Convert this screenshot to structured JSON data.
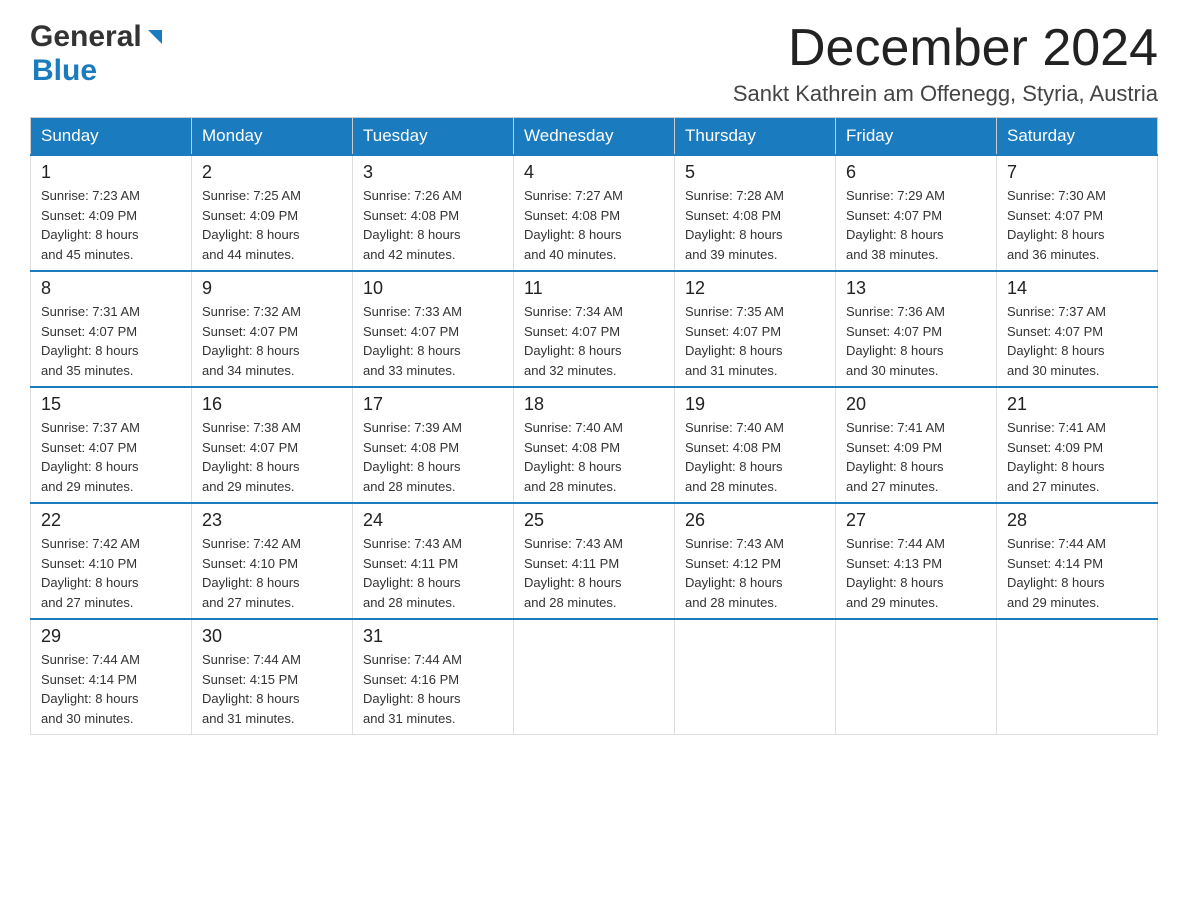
{
  "header": {
    "logo_general": "General",
    "logo_blue": "Blue",
    "month_year": "December 2024",
    "location": "Sankt Kathrein am Offenegg, Styria, Austria"
  },
  "weekdays": [
    "Sunday",
    "Monday",
    "Tuesday",
    "Wednesday",
    "Thursday",
    "Friday",
    "Saturday"
  ],
  "weeks": [
    [
      {
        "day": "1",
        "sunrise": "7:23 AM",
        "sunset": "4:09 PM",
        "daylight": "8 hours and 45 minutes."
      },
      {
        "day": "2",
        "sunrise": "7:25 AM",
        "sunset": "4:09 PM",
        "daylight": "8 hours and 44 minutes."
      },
      {
        "day": "3",
        "sunrise": "7:26 AM",
        "sunset": "4:08 PM",
        "daylight": "8 hours and 42 minutes."
      },
      {
        "day": "4",
        "sunrise": "7:27 AM",
        "sunset": "4:08 PM",
        "daylight": "8 hours and 40 minutes."
      },
      {
        "day": "5",
        "sunrise": "7:28 AM",
        "sunset": "4:08 PM",
        "daylight": "8 hours and 39 minutes."
      },
      {
        "day": "6",
        "sunrise": "7:29 AM",
        "sunset": "4:07 PM",
        "daylight": "8 hours and 38 minutes."
      },
      {
        "day": "7",
        "sunrise": "7:30 AM",
        "sunset": "4:07 PM",
        "daylight": "8 hours and 36 minutes."
      }
    ],
    [
      {
        "day": "8",
        "sunrise": "7:31 AM",
        "sunset": "4:07 PM",
        "daylight": "8 hours and 35 minutes."
      },
      {
        "day": "9",
        "sunrise": "7:32 AM",
        "sunset": "4:07 PM",
        "daylight": "8 hours and 34 minutes."
      },
      {
        "day": "10",
        "sunrise": "7:33 AM",
        "sunset": "4:07 PM",
        "daylight": "8 hours and 33 minutes."
      },
      {
        "day": "11",
        "sunrise": "7:34 AM",
        "sunset": "4:07 PM",
        "daylight": "8 hours and 32 minutes."
      },
      {
        "day": "12",
        "sunrise": "7:35 AM",
        "sunset": "4:07 PM",
        "daylight": "8 hours and 31 minutes."
      },
      {
        "day": "13",
        "sunrise": "7:36 AM",
        "sunset": "4:07 PM",
        "daylight": "8 hours and 30 minutes."
      },
      {
        "day": "14",
        "sunrise": "7:37 AM",
        "sunset": "4:07 PM",
        "daylight": "8 hours and 30 minutes."
      }
    ],
    [
      {
        "day": "15",
        "sunrise": "7:37 AM",
        "sunset": "4:07 PM",
        "daylight": "8 hours and 29 minutes."
      },
      {
        "day": "16",
        "sunrise": "7:38 AM",
        "sunset": "4:07 PM",
        "daylight": "8 hours and 29 minutes."
      },
      {
        "day": "17",
        "sunrise": "7:39 AM",
        "sunset": "4:08 PM",
        "daylight": "8 hours and 28 minutes."
      },
      {
        "day": "18",
        "sunrise": "7:40 AM",
        "sunset": "4:08 PM",
        "daylight": "8 hours and 28 minutes."
      },
      {
        "day": "19",
        "sunrise": "7:40 AM",
        "sunset": "4:08 PM",
        "daylight": "8 hours and 28 minutes."
      },
      {
        "day": "20",
        "sunrise": "7:41 AM",
        "sunset": "4:09 PM",
        "daylight": "8 hours and 27 minutes."
      },
      {
        "day": "21",
        "sunrise": "7:41 AM",
        "sunset": "4:09 PM",
        "daylight": "8 hours and 27 minutes."
      }
    ],
    [
      {
        "day": "22",
        "sunrise": "7:42 AM",
        "sunset": "4:10 PM",
        "daylight": "8 hours and 27 minutes."
      },
      {
        "day": "23",
        "sunrise": "7:42 AM",
        "sunset": "4:10 PM",
        "daylight": "8 hours and 27 minutes."
      },
      {
        "day": "24",
        "sunrise": "7:43 AM",
        "sunset": "4:11 PM",
        "daylight": "8 hours and 28 minutes."
      },
      {
        "day": "25",
        "sunrise": "7:43 AM",
        "sunset": "4:11 PM",
        "daylight": "8 hours and 28 minutes."
      },
      {
        "day": "26",
        "sunrise": "7:43 AM",
        "sunset": "4:12 PM",
        "daylight": "8 hours and 28 minutes."
      },
      {
        "day": "27",
        "sunrise": "7:44 AM",
        "sunset": "4:13 PM",
        "daylight": "8 hours and 29 minutes."
      },
      {
        "day": "28",
        "sunrise": "7:44 AM",
        "sunset": "4:14 PM",
        "daylight": "8 hours and 29 minutes."
      }
    ],
    [
      {
        "day": "29",
        "sunrise": "7:44 AM",
        "sunset": "4:14 PM",
        "daylight": "8 hours and 30 minutes."
      },
      {
        "day": "30",
        "sunrise": "7:44 AM",
        "sunset": "4:15 PM",
        "daylight": "8 hours and 31 minutes."
      },
      {
        "day": "31",
        "sunrise": "7:44 AM",
        "sunset": "4:16 PM",
        "daylight": "8 hours and 31 minutes."
      },
      null,
      null,
      null,
      null
    ]
  ],
  "labels": {
    "sunrise": "Sunrise:",
    "sunset": "Sunset:",
    "daylight": "Daylight:"
  }
}
